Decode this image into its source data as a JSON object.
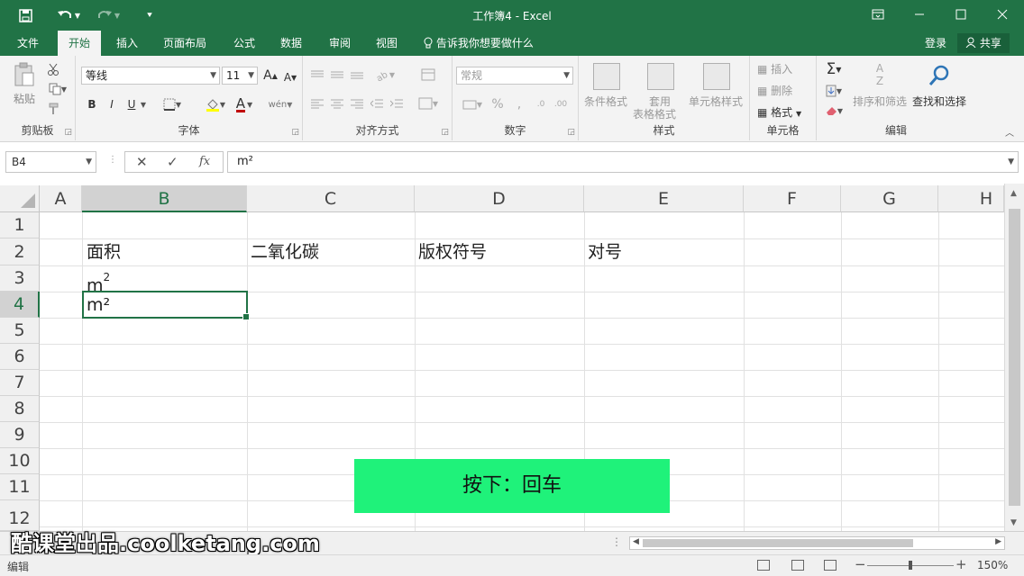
{
  "title_bar": {
    "title": "工作簿4 - Excel",
    "save_icon": "save-icon",
    "undo_icon": "undo-icon",
    "redo_icon": "redo-icon",
    "customize_icon": "customize-qat-icon"
  },
  "menu": {
    "tabs": [
      "文件",
      "开始",
      "插入",
      "页面布局",
      "公式",
      "数据",
      "审阅",
      "视图"
    ],
    "active_tab": "开始",
    "tell_me": "告诉我你想要做什么",
    "login": "登录",
    "share": "共享"
  },
  "ribbon": {
    "clipboard": {
      "paste": "粘贴",
      "label": "剪贴板"
    },
    "font": {
      "name": "等线",
      "size": "11",
      "bold": "B",
      "italic": "I",
      "underline": "U",
      "label": "字体"
    },
    "alignment": {
      "label": "对齐方式"
    },
    "number": {
      "format": "常规",
      "label": "数字"
    },
    "styles": {
      "conditional": "条件格式",
      "table_format_1": "套用",
      "table_format_2": "表格格式",
      "cell_styles": "单元格样式",
      "label": "样式"
    },
    "cells": {
      "insert": "插入",
      "delete": "删除",
      "format": "格式",
      "label": "单元格"
    },
    "editing": {
      "sort_filter": "排序和筛选",
      "find_select": "查找和选择",
      "label": "编辑"
    }
  },
  "formula_bar": {
    "name_box": "B4",
    "fx": "fx",
    "formula": "m²"
  },
  "sheet": {
    "columns": [
      "A",
      "B",
      "C",
      "D",
      "E",
      "F",
      "G",
      "H"
    ],
    "rows": [
      "1",
      "2",
      "3",
      "4",
      "5",
      "6",
      "7",
      "8",
      "9",
      "10",
      "11",
      "12"
    ],
    "selected_cell": "B4",
    "cells": {
      "B2": "面积",
      "C2": "二氧化碳",
      "D2": "版权符号",
      "E2": "对号",
      "B3_base": "m",
      "B3_sup": "2",
      "B4": "m²"
    }
  },
  "overlay": {
    "text": "按下：回车"
  },
  "watermark": "酷课堂出品.coolketang.com",
  "status_bar": {
    "mode": "编辑",
    "zoom": "150%"
  },
  "colors": {
    "accent": "#217346",
    "overlay": "#1ff27a"
  }
}
